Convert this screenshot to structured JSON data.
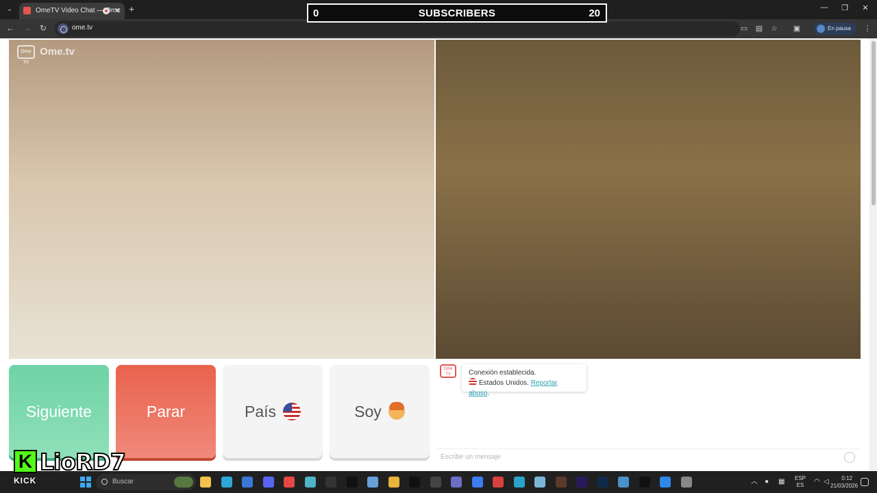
{
  "browser": {
    "tab_title": "OmeTV Video Chat — Ome",
    "tab_close": "✕",
    "new_tab": "+",
    "url": "ome.tv",
    "profile_status": "En pausa"
  },
  "overlay": {
    "left_count": "0",
    "title": "SUBSCRIBERS",
    "right_count": "20"
  },
  "video": {
    "logo_text": "Ome.tv",
    "logo_badge": "Ome TV"
  },
  "controls": {
    "next_label": "Siguiente",
    "stop_label": "Parar",
    "country_label": "País",
    "gender_label": "Soy"
  },
  "chat": {
    "avatar_badge": "Ome TV",
    "connection_text": "Conexión establecida.",
    "country_text": "Estados Unidos.",
    "report_link": "Reportar abuso",
    "report_suffix": ".",
    "input_placeholder": "Escribe un mensaje"
  },
  "stream_overlay": {
    "platform": "KICK",
    "platform_letter": "K",
    "streamer": "LioRD7"
  },
  "taskbar": {
    "search_placeholder": "Buscar",
    "lang_top": "ESP",
    "lang_bottom": "ES",
    "time": "0:12",
    "date": "21/03/2026",
    "apps": [
      {
        "name": "file-explorer-icon",
        "color": "#f2c14e"
      },
      {
        "name": "edge-icon",
        "color": "#2fa6d8"
      },
      {
        "name": "store-icon",
        "color": "#3a78d8"
      },
      {
        "name": "discord-icon",
        "color": "#5865f2"
      },
      {
        "name": "app-icon",
        "color": "#e54747"
      },
      {
        "name": "photos-icon",
        "color": "#4fb3c9"
      },
      {
        "name": "epic-icon",
        "color": "#333333"
      },
      {
        "name": "capcut-icon",
        "color": "#111111"
      },
      {
        "name": "app-window-icon",
        "color": "#6a9ed8"
      },
      {
        "name": "chrome-icon",
        "color": "#e8b23b"
      },
      {
        "name": "tiktok-icon",
        "color": "#111111"
      },
      {
        "name": "app-dots-icon",
        "color": "#444444"
      },
      {
        "name": "teams-icon",
        "color": "#6b6fc8"
      },
      {
        "name": "app-blue-icon",
        "color": "#3d7cf2"
      },
      {
        "name": "app-red-icon",
        "color": "#d94040"
      },
      {
        "name": "app-cyan-icon",
        "color": "#29a3c9"
      },
      {
        "name": "notepad-icon",
        "color": "#7cb6d6"
      },
      {
        "name": "game-icon",
        "color": "#5a3a2a"
      },
      {
        "name": "premiere-icon",
        "color": "#2a1a5c"
      },
      {
        "name": "photoshop-icon",
        "color": "#0f2a4a"
      },
      {
        "name": "app-window2-icon",
        "color": "#4a90c9"
      },
      {
        "name": "capcut2-icon",
        "color": "#111111"
      },
      {
        "name": "app-circle-icon",
        "color": "#2e88e8"
      },
      {
        "name": "recycle-icon",
        "color": "#888888"
      }
    ]
  }
}
